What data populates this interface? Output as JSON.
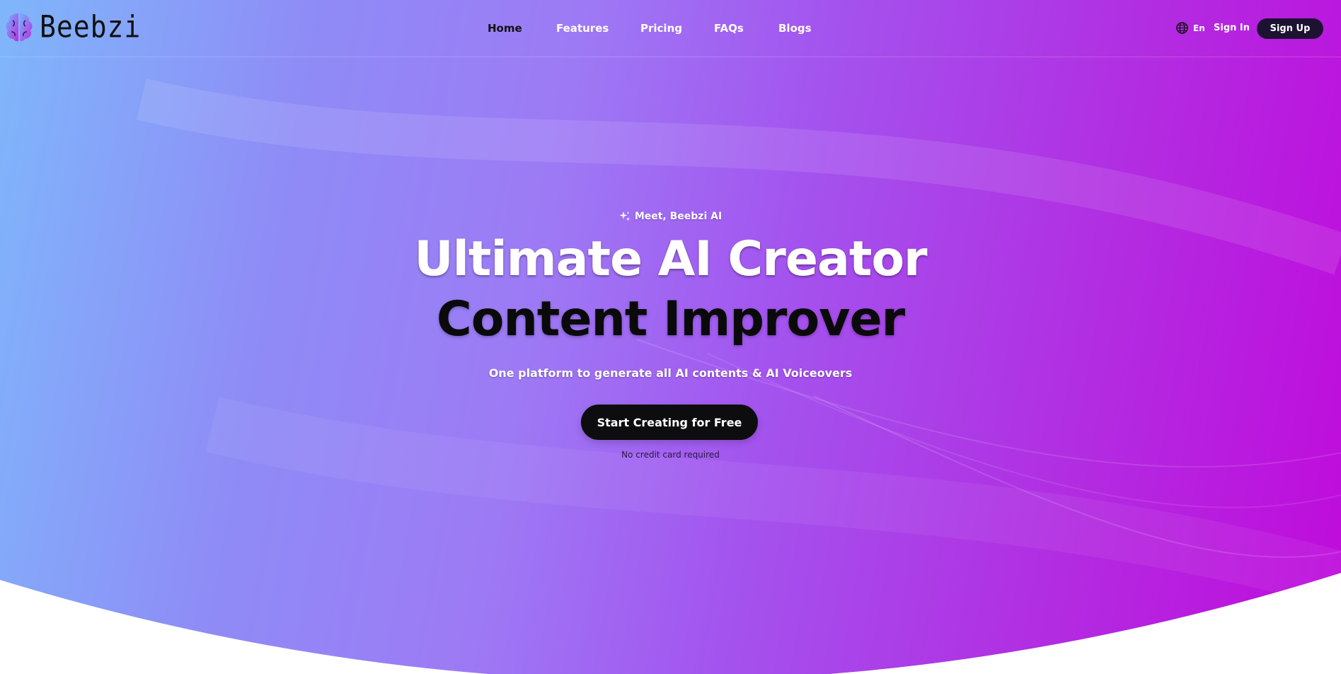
{
  "brand": {
    "name": "Beebzi",
    "logo_icon": "brain-icon"
  },
  "nav": {
    "items": [
      {
        "label": "Home",
        "active": true
      },
      {
        "label": "Features",
        "active": false
      },
      {
        "label": "Pricing",
        "active": false
      },
      {
        "label": "FAQs",
        "active": false
      },
      {
        "label": "Blogs",
        "active": false
      }
    ]
  },
  "header_actions": {
    "language_icon": "globe-icon",
    "language": "En",
    "sign_in": "Sign In",
    "sign_up": "Sign Up"
  },
  "hero": {
    "badge_icon": "sparkle-icon",
    "badge": "Meet, Beebzi AI",
    "headline_line1": "Ultimate AI Creator",
    "headline_line2": "Content Improver",
    "subtitle": "One platform to generate all AI contents & AI Voiceovers",
    "cta_label": "Start Creating for Free",
    "note": "No credit card required"
  },
  "colors": {
    "gradient_start": "#7fb6fb",
    "gradient_mid": "#9d7af5",
    "gradient_end": "#c00adb",
    "cta_background": "#0d0d0f",
    "signup_background": "#1d1232"
  }
}
